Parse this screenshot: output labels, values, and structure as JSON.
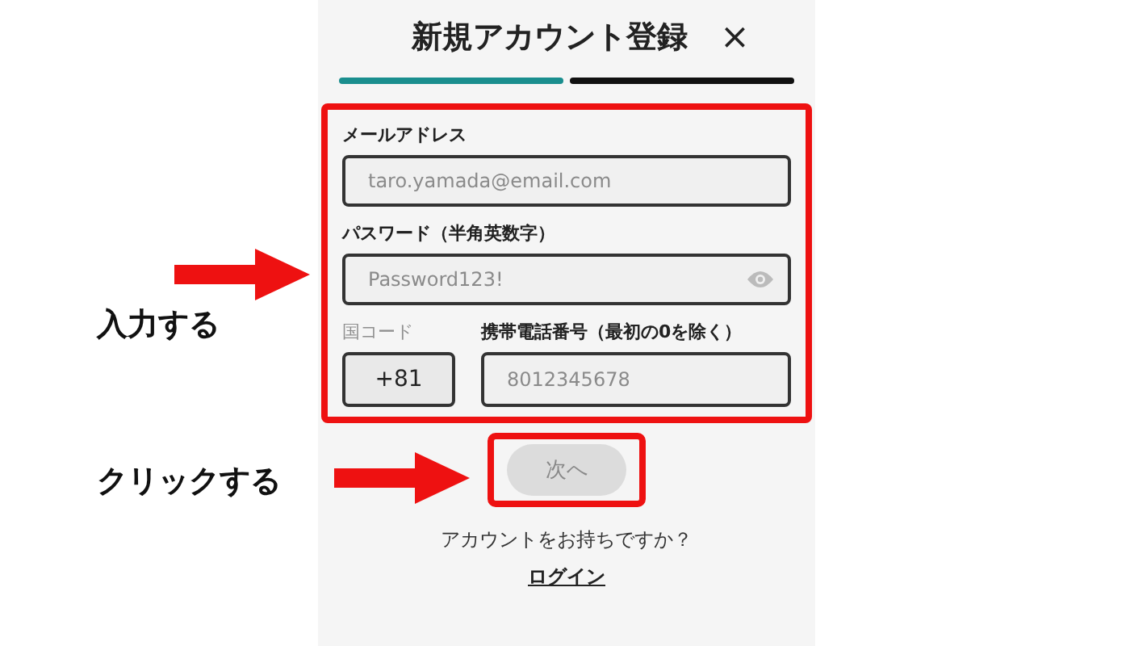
{
  "title": "新規アカウント登録",
  "close": "×",
  "steps": [
    {
      "active": true
    },
    {
      "active": false
    }
  ],
  "fields": [
    {
      "kind": "text",
      "label": "メールアドレス",
      "placeholder": "taro.yamada@email.com"
    },
    {
      "kind": "password",
      "label": "パスワード（半角英数字）",
      "placeholder": "Password123!"
    }
  ],
  "phone": {
    "code_label": "国コード",
    "code": "+81",
    "label": "携帯電話番号（最初の0を除く）",
    "placeholder": "8012345678"
  },
  "next_button": {
    "label": "次へ",
    "disabled": true
  },
  "login_prompt": "アカウントをお持ちですか？",
  "login_link": "ログイン",
  "annotations": [
    {
      "text": "入力する"
    },
    {
      "text": "クリックする"
    }
  ]
}
